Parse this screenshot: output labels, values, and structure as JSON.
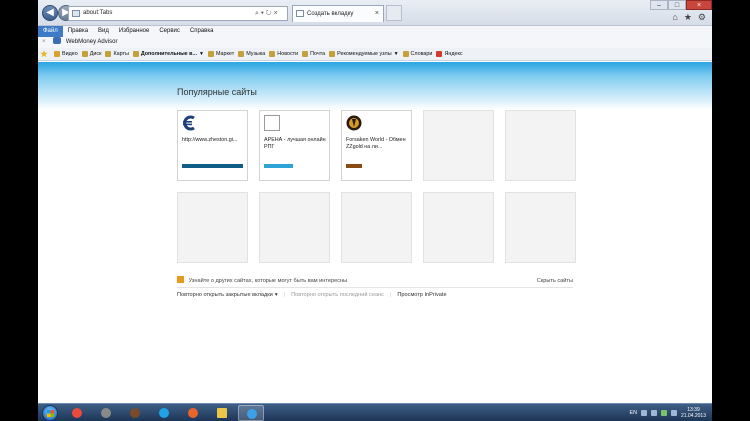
{
  "titlebar": {
    "address": "about:Tabs",
    "address_tools": "⌕ ▾ ↻ ×",
    "tab_title": "Создать вкладку",
    "tab_close": "×",
    "win_min": "–",
    "win_max": "□",
    "win_close": "×",
    "right_icons": [
      "⌂",
      "★",
      "⚙"
    ]
  },
  "menu": [
    {
      "label": "Файл",
      "active": true
    },
    {
      "label": "Правка"
    },
    {
      "label": "Вид"
    },
    {
      "label": "Избранное"
    },
    {
      "label": "Сервис"
    },
    {
      "label": "Справка"
    }
  ],
  "toolbar": {
    "close": "×",
    "webmoney_label": "WebMoney Advisor"
  },
  "favorites": {
    "items": [
      {
        "label": "Видео",
        "color": "#d9a42b"
      },
      {
        "label": "Диск",
        "color": "#c6a03a"
      },
      {
        "label": "Карты",
        "color": "#c6a03a"
      },
      {
        "label": "Дополнительные в...",
        "color": "#c6a03a",
        "dropdown": true,
        "bold": true
      },
      {
        "label": "Маркет",
        "color": "#c6a03a"
      },
      {
        "label": "Музыка",
        "color": "#c6a03a"
      },
      {
        "label": "Новости",
        "color": "#c6a03a"
      },
      {
        "label": "Почта",
        "color": "#c6a03a"
      },
      {
        "label": "Рекомендуемые узлы",
        "color": "#c6a03a",
        "dropdown": true
      },
      {
        "label": "Словари",
        "color": "#c6a03a"
      },
      {
        "label": "Яндекс",
        "color": "#d33a2c"
      }
    ]
  },
  "main": {
    "heading": "Популярные сайты",
    "tiles": [
      {
        "title": "http://www.zheston.gi...",
        "icon": "euro",
        "bar_color": "#0f5c86",
        "bar_fraction": 0.95
      },
      {
        "title": "АРЕНА - лучшая онлайн РПГ",
        "icon": "blank",
        "bar_color": "#2ea3d8",
        "bar_fraction": 0.45
      },
      {
        "title": "Forsaken World - Обмен ZZgold на ли...",
        "icon": "fw",
        "bar_color": "#8a4a12",
        "bar_fraction": 0.25
      },
      {},
      {},
      {},
      {},
      {},
      {},
      {}
    ],
    "info_text": "Узнайте о других сайтах, которые могут быть вам интересны",
    "hide_sites": "Скрыть сайты",
    "reopen_closed": "Повторно открыть закрытые вкладки",
    "reopen_closed_dd": "▾",
    "reopen_last": "Повторно открыть последний сеанс",
    "inprivate": "Просмотр InPrivate",
    "sep": "|"
  },
  "taskbar": {
    "apps": [
      {
        "name": "chrome",
        "color": "#e94b3c"
      },
      {
        "name": "media",
        "color": "#8a8a8a"
      },
      {
        "name": "game",
        "color": "#7a4a2a"
      },
      {
        "name": "skype",
        "color": "#1fa3e6"
      },
      {
        "name": "player",
        "color": "#e8642a"
      },
      {
        "name": "explorer",
        "color": "#e9c64a"
      },
      {
        "name": "ie",
        "color": "#3aa0e8"
      }
    ],
    "lang": "EN",
    "time": "13:39",
    "date": "21.04.2013"
  }
}
